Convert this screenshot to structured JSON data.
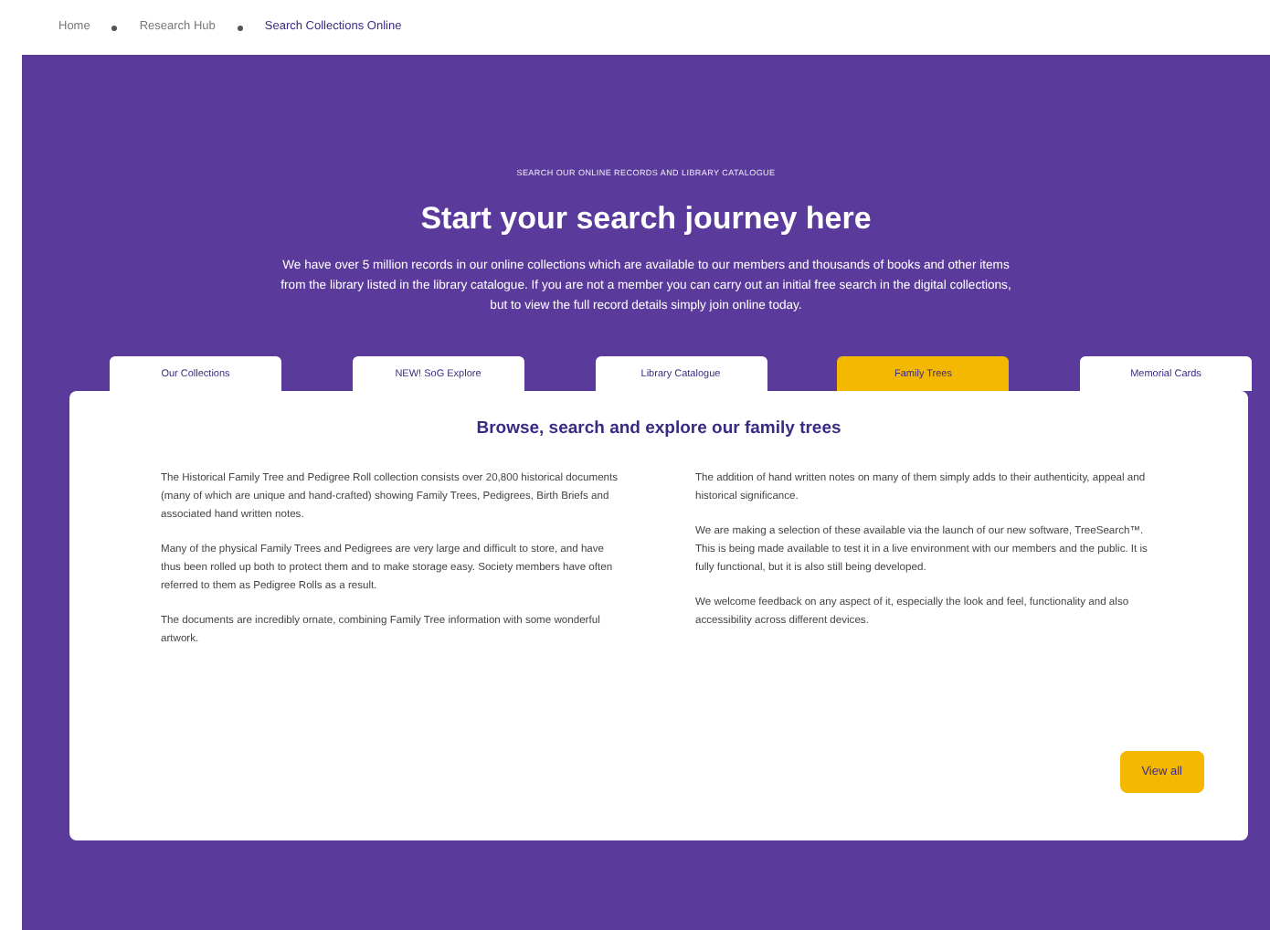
{
  "breadcrumbs": [
    {
      "label": "Home",
      "current": false
    },
    {
      "label": "Research Hub",
      "current": false
    },
    {
      "label": "Search Collections Online",
      "current": true
    }
  ],
  "hero": {
    "eyebrow": "SEARCH OUR ONLINE RECORDS AND LIBRARY CATALOGUE",
    "title": "Start your search journey here",
    "intro": "We have over 5 million records in our online collections which are available to our members and thousands of books and other items from the library listed in the library catalogue. If you are not a member you can carry out an initial free search in the digital collections, but to view the full record details simply join online today."
  },
  "tabs": [
    {
      "label": "Our Collections",
      "selected": false
    },
    {
      "label": "NEW! SoG Explore",
      "selected": false
    },
    {
      "label": "Library Catalogue",
      "selected": false
    },
    {
      "label": "Family Trees",
      "selected": true
    },
    {
      "label": "Memorial Cards",
      "selected": false
    }
  ],
  "panel": {
    "heading": "Browse, search and explore our family trees",
    "left_paragraphs": [
      "The Historical Family Tree and Pedigree Roll collection consists over 20,800 historical documents (many of which are unique and hand-crafted) showing Family Trees, Pedigrees, Birth Briefs and associated hand written notes.",
      "Many of the physical Family Trees and Pedigrees are very large and difficult to store, and have thus been rolled up both to protect them and to make storage easy. Society members have often referred to them as Pedigree Rolls as a result.",
      "The documents are incredibly ornate, combining Family Tree information with some wonderful artwork."
    ],
    "right_paragraphs": [
      "The addition of hand written notes on many of them simply adds to their authenticity, appeal and historical significance.",
      "We are making a selection of these available via the launch of our new software, TreeSearch™. This is being made available to test it in a live environment with our members and the public. It is fully functional, but it is also still being developed.",
      "We welcome feedback on any aspect of it, especially the look and feel, functionality and also accessibility across different devices."
    ],
    "button": "View all"
  }
}
